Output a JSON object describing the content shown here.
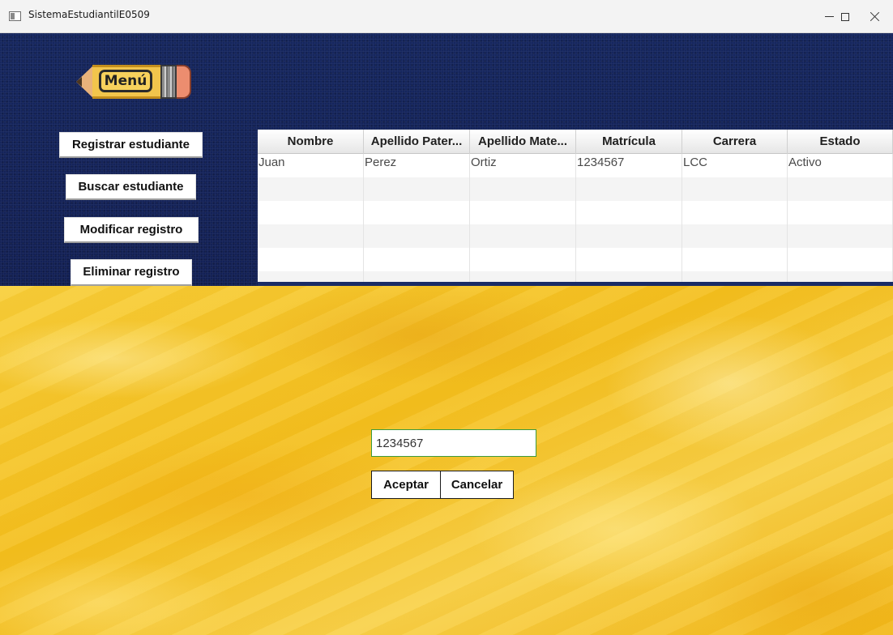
{
  "window": {
    "title": "SistemaEstudiantilE0509",
    "controls": [
      "minimize-icon",
      "maximize-icon",
      "close-icon"
    ]
  },
  "menu": {
    "label": "Menú"
  },
  "nav": {
    "register": "Registrar estudiante",
    "search": "Buscar estudiante",
    "modify": "Modificar registro",
    "delete": "Eliminar registro"
  },
  "table": {
    "columns": [
      "Nombre",
      "Apellido Pater...",
      "Apellido Mate...",
      "Matrícula",
      "Carrera",
      "Estado"
    ],
    "rows": [
      [
        "Juan",
        "Perez",
        "Ortiz",
        "1234567",
        "LCC",
        "Activo"
      ]
    ]
  },
  "form": {
    "matricula_value": "1234567",
    "accept_label": "Aceptar",
    "cancel_label": "Cancelar"
  },
  "colors": {
    "top_panel": "#0f1f58",
    "bottom_panel": "#f4c01e",
    "input_border": "#3d9a3d"
  }
}
